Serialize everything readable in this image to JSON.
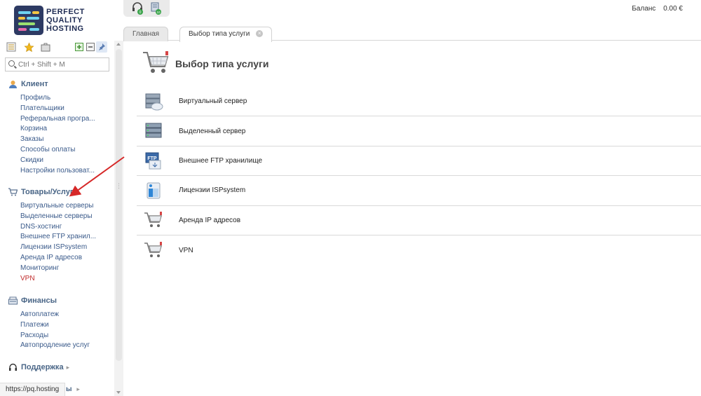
{
  "brand": {
    "logo_text": [
      "PERFECT",
      "QUALITY",
      "HOSTING"
    ],
    "accent": "#2d3a63"
  },
  "sidebar": {
    "search_placeholder": "Ctrl + Shift + M",
    "sections": [
      {
        "title": "Клиент",
        "icon": "client-icon",
        "items": [
          {
            "label": "Профиль"
          },
          {
            "label": "Плательщики"
          },
          {
            "label": "Реферальная програ..."
          },
          {
            "label": "Корзина"
          },
          {
            "label": "Заказы"
          },
          {
            "label": "Способы оплаты"
          },
          {
            "label": "Скидки"
          },
          {
            "label": "Настройки пользоват..."
          }
        ]
      },
      {
        "title": "Товары/Услуги",
        "icon": "cart-icon",
        "items": [
          {
            "label": "Виртуальные серверы"
          },
          {
            "label": "Выделенные серверы"
          },
          {
            "label": "DNS-хостинг"
          },
          {
            "label": "Внешнее FTP хранил..."
          },
          {
            "label": "Лицензии ISPsystem"
          },
          {
            "label": "Аренда IP адресов"
          },
          {
            "label": "Мониторинг"
          },
          {
            "label": "VPN",
            "active": true
          }
        ]
      },
      {
        "title": "Финансы",
        "icon": "finance-icon",
        "items": [
          {
            "label": "Автоплатеж"
          },
          {
            "label": "Платежи"
          },
          {
            "label": "Расходы"
          },
          {
            "label": "Автопродление услуг"
          }
        ]
      }
    ],
    "support": {
      "title": "Поддержка",
      "icon": "headset-icon"
    },
    "cut_section_suffix": "ы"
  },
  "statusbar": {
    "url": "https://pq.hosting"
  },
  "topbar": {
    "notif_badges": [
      "0",
      "10"
    ],
    "balance_label": "Баланс",
    "balance_value": "0.00 €"
  },
  "tabs": [
    {
      "label": "Главная",
      "active": false
    },
    {
      "label": "Выбор типа услуги",
      "active": true
    }
  ],
  "page": {
    "title": "Выбор типа услуги",
    "services": [
      {
        "label": "Виртуальный сервер",
        "icon": "virtual-server-icon"
      },
      {
        "label": "Выделенный сервер",
        "icon": "dedicated-server-icon"
      },
      {
        "label": "Внешнее FTP хранилище",
        "icon": "ftp-storage-icon"
      },
      {
        "label": "Лицензии ISPsystem",
        "icon": "ispsystem-license-icon"
      },
      {
        "label": "Аренда IP адресов",
        "icon": "ip-rent-cart-icon"
      },
      {
        "label": "VPN",
        "icon": "vpn-cart-icon"
      }
    ]
  },
  "colors": {
    "link": "#3a5a8a",
    "active_link": "#c02a2a",
    "section_head": "#4a6687",
    "annotation_arrow": "#d62828"
  }
}
